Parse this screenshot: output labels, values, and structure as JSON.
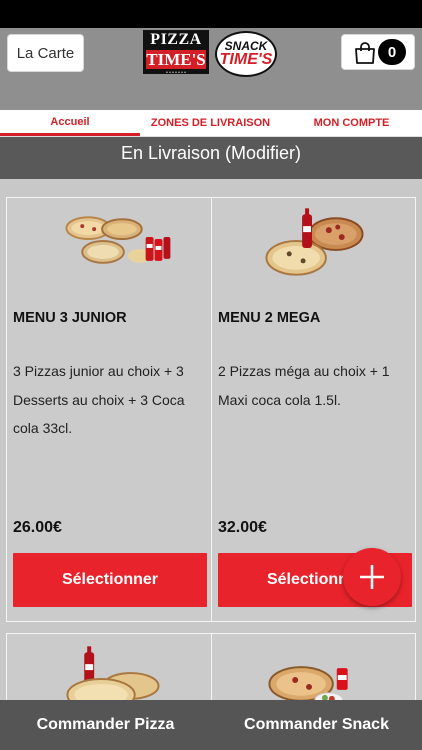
{
  "header": {
    "carte_label": "La Carte",
    "logo_pizza": {
      "line1": "PIZZA",
      "line2": "TIME'S"
    },
    "logo_snack": {
      "line1": "SNACK",
      "line2": "TIME'S"
    },
    "cart_count": "0",
    "icons": {
      "cart": "shopping-bag-icon"
    }
  },
  "tabs": [
    {
      "label": "Accueil",
      "active": true
    },
    {
      "label": "ZONES DE LIVRAISON",
      "active": false
    },
    {
      "label": "MON COMPTE",
      "active": false
    }
  ],
  "delivery": {
    "label": "En Livraison (Modifier)"
  },
  "menus": [
    {
      "title": "MENU 3 JUNIOR",
      "description": "3 Pizzas junior au choix  + 3 Desserts au choix  + 3 Coca cola 33cl.",
      "price": "26.00€",
      "button": "Sélectionner"
    },
    {
      "title": "MENU 2 MEGA",
      "description": "2 Pizzas méga au choix  + 1 Maxi coca cola 1.5l.",
      "price": "32.00€",
      "button": "Sélectionner"
    }
  ],
  "bottom_bar": {
    "pizza_label": "Commander Pizza",
    "snack_label": "Commander Snack"
  },
  "colors": {
    "accent": "#e8232b",
    "header_bg": "#8f8f8f",
    "delivery_bg": "#595959",
    "content_bg": "#c8c8c8",
    "bottom_bg": "#555555"
  },
  "fab_icon": "plus-icon"
}
